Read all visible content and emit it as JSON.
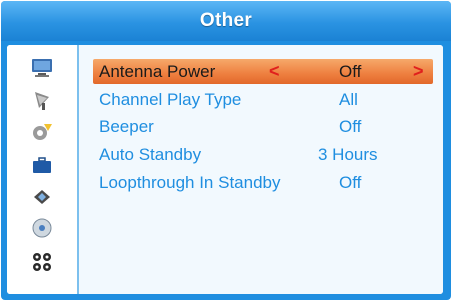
{
  "window": {
    "title": "Other"
  },
  "sidebar": {
    "icons": [
      {
        "name": "tv-icon"
      },
      {
        "name": "satellite-dish-icon"
      },
      {
        "name": "settings-gear-icon"
      },
      {
        "name": "briefcase-icon"
      },
      {
        "name": "network-icon"
      },
      {
        "name": "disc-icon"
      },
      {
        "name": "multimedia-icon"
      }
    ]
  },
  "menu": {
    "items": [
      {
        "label": "Antenna Power",
        "value": "Off",
        "selected": true,
        "left_arrow": "<",
        "right_arrow": ">"
      },
      {
        "label": "Channel Play Type",
        "value": "All"
      },
      {
        "label": "Beeper",
        "value": "Off"
      },
      {
        "label": "Auto Standby",
        "value": "3 Hours"
      },
      {
        "label": "Loopthrough In Standby",
        "value": "Off"
      }
    ]
  },
  "colors": {
    "frame_blue": "#1f8ee0",
    "selection_orange": "#ee7f3f",
    "arrow_red": "#e0201d",
    "text_blue": "#1f8ee0"
  }
}
